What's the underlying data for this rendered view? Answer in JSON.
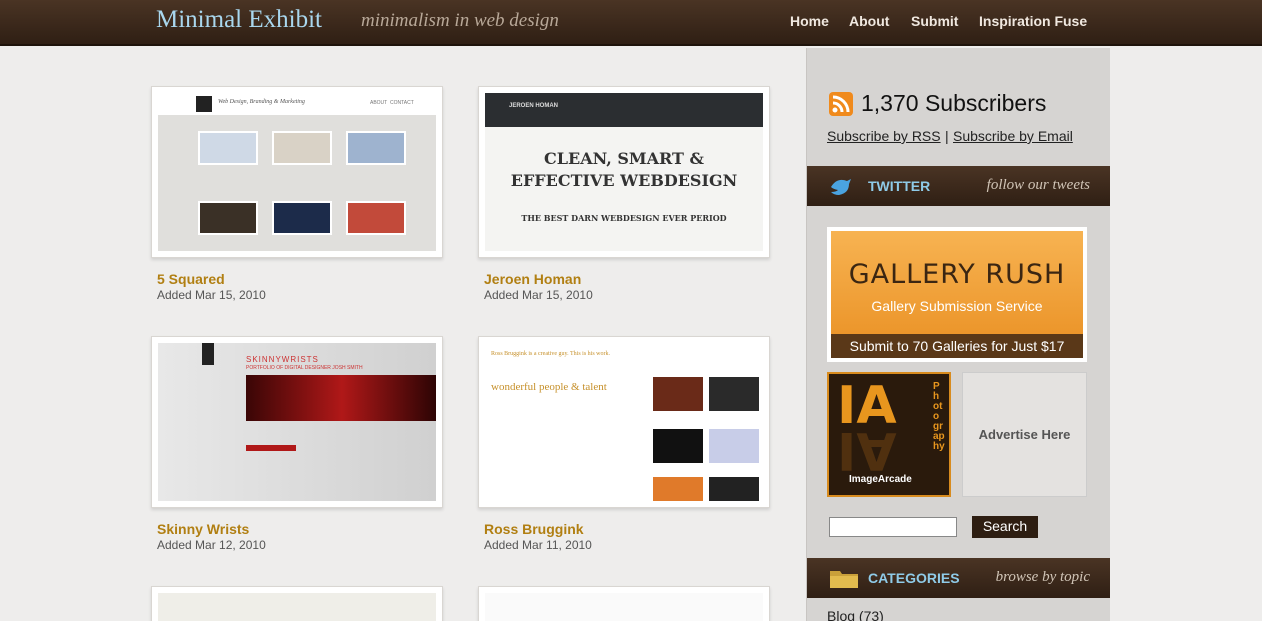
{
  "header": {
    "site_title": "Minimal Exhibit",
    "tagline": "minimalism in web design",
    "nav": [
      "Home",
      "About",
      "Submit",
      "Inspiration Fuse"
    ]
  },
  "entries": [
    {
      "title": "5 Squared",
      "date": "Added Mar 15, 2010"
    },
    {
      "title": "Jeroen Homan",
      "date": "Added Mar 15, 2010"
    },
    {
      "title": "Skinny Wrists",
      "date": "Added Mar 12, 2010"
    },
    {
      "title": "Ross Bruggink",
      "date": "Added Mar 11, 2010"
    }
  ],
  "thumbs": {
    "squared_header": "Web Design, Branding & Marketing",
    "squared_nav": [
      "ABOUT",
      "CONTACT"
    ],
    "jeroen_name": "JEROEN HOMAN",
    "jeroen_line1": "CLEAN, SMART &",
    "jeroen_line2": "EFFECTIVE WEBDESIGN",
    "jeroen_quote": "THE BEST DARN WEBDESIGN EVER PERIOD",
    "skinny_title": "SKINNYWRISTS",
    "skinny_sub": "PORTFOLIO OF DIGITAL DESIGNER JOSH SMITH",
    "ross_header": "Ross Bruggink is a creative guy. This is his work.",
    "ross_heading": "wonderful people & talent"
  },
  "sidebar": {
    "subscribers": "1,370 Subscribers",
    "subscribe_rss": "Subscribe by RSS",
    "separator": "|",
    "subscribe_email": "Subscribe by Email",
    "twitter_label": "TWITTER",
    "twitter_sub": "follow our tweets",
    "ad_title": "GALLERY RUSH",
    "ad_sub": "Gallery Submission Service",
    "ad_strip": "Submit to 70 Galleries for Just $17",
    "ia_letters": "IA",
    "ia_vertical": "Photography",
    "ia_name": "ImageArcade",
    "advertise": "Advertise Here",
    "search_button": "Search",
    "categories_label": "CATEGORIES",
    "categories_sub": "browse by topic",
    "first_category": "Blog (73)"
  },
  "colors": {
    "header_bg": "#3b2819",
    "title_blue": "#a9d7ee",
    "entry_title": "#b17f12",
    "sidebar_bg": "#d6d4d2"
  }
}
